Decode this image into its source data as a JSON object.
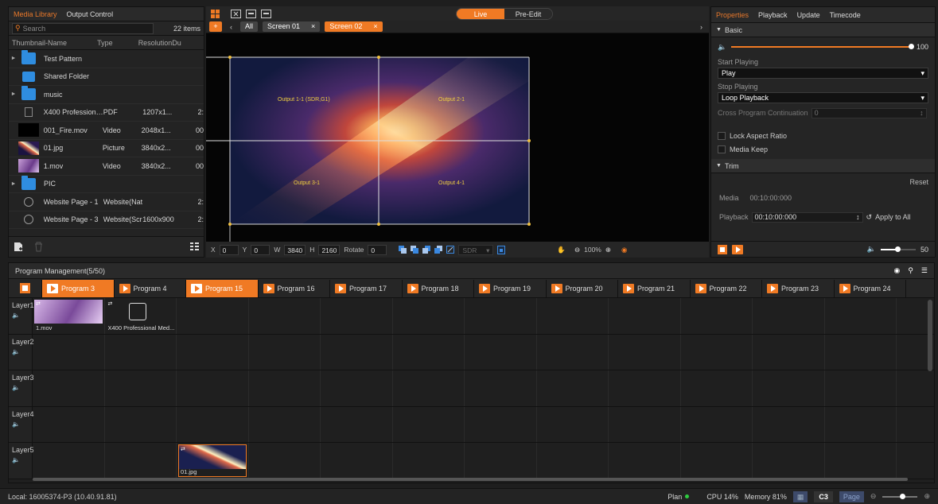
{
  "left_panel": {
    "tabs": [
      "Media Library",
      "Output Control"
    ],
    "search_placeholder": "Search",
    "item_count": "22 items",
    "columns": [
      "Thumbnail-Name",
      "Type",
      "Resolution",
      "Du"
    ],
    "items": [
      {
        "name": "Test Pattern",
        "type": "",
        "res": "",
        "dur": "",
        "kind": "folder",
        "expandable": true
      },
      {
        "name": "Shared Folder",
        "type": "",
        "res": "",
        "dur": "",
        "kind": "shared",
        "expandable": false
      },
      {
        "name": "music",
        "type": "",
        "res": "",
        "dur": "",
        "kind": "folder",
        "expandable": true
      },
      {
        "name": "X400 Professiona...",
        "type": "PDF",
        "res": "1207x1...",
        "dur": "2:",
        "kind": "pdf",
        "expandable": false
      },
      {
        "name": "001_Fire.mov",
        "type": "Video",
        "res": "2048x1...",
        "dur": "00",
        "kind": "black",
        "expandable": false
      },
      {
        "name": "01.jpg",
        "type": "Picture",
        "res": "3840x2...",
        "dur": "00",
        "kind": "galaxy",
        "expandable": false
      },
      {
        "name": "1.mov",
        "type": "Video",
        "res": "3840x2...",
        "dur": "00",
        "kind": "purple",
        "expandable": false
      },
      {
        "name": "PIC",
        "type": "",
        "res": "",
        "dur": "",
        "kind": "folder",
        "expandable": true
      },
      {
        "name": "Website Page - 1",
        "type": "Website(Nat...",
        "res": "",
        "dur": "2:",
        "kind": "globe",
        "expandable": false
      },
      {
        "name": "Website Page - 3",
        "type": "Website(Scr...",
        "res": "1600x900",
        "dur": "2:",
        "kind": "globe",
        "expandable": false
      }
    ]
  },
  "center": {
    "live_label": "Live",
    "preedit_label": "Pre-Edit",
    "screen_tabs": [
      "All",
      "Screen 01",
      "Screen 02"
    ],
    "outputs": [
      "Output 1-1 (SDR,G1)",
      "Output 2-1",
      "Output 3-1",
      "Output 4-1"
    ],
    "toolbar": {
      "x_label": "X",
      "x_value": "0",
      "y_label": "Y",
      "y_value": "0",
      "w_label": "W",
      "w_value": "3840",
      "h_label": "H",
      "h_value": "2160",
      "rotate_label": "Rotate",
      "rotate_value": "0",
      "sdr_label": "SDR",
      "zoom": "100%"
    }
  },
  "right_panel": {
    "tabs": [
      "Properties",
      "Playback",
      "Update",
      "Timecode"
    ],
    "basic_label": "Basic",
    "volume_value": "100",
    "volume_level": 1.0,
    "start_playing_label": "Start Playing",
    "start_playing_value": "Play",
    "stop_playing_label": "Stop Playing",
    "stop_playing_value": "Loop Playback",
    "cross_program_label": "Cross Program Continuation",
    "cross_program_value": "0",
    "lock_aspect_label": "Lock Aspect Ratio",
    "media_keep_label": "Media Keep",
    "trim_label": "Trim",
    "reset_label": "Reset",
    "media_label": "Media",
    "media_time": "00:10:00:000",
    "playback_label": "Playback",
    "playback_time": "00:10:00:000",
    "apply_all_label": "Apply to All",
    "bottom_volume_value": "50",
    "bottom_volume_level": 0.5
  },
  "program": {
    "title": "Program Management(5/50)",
    "tabs": [
      {
        "label": "Program 3",
        "active": true
      },
      {
        "label": "Program 4",
        "active": false
      },
      {
        "label": "Program 15",
        "active": true
      },
      {
        "label": "Program 16",
        "active": false
      },
      {
        "label": "Program 17",
        "active": false
      },
      {
        "label": "Program 18",
        "active": false
      },
      {
        "label": "Program 19",
        "active": false
      },
      {
        "label": "Program 20",
        "active": false
      },
      {
        "label": "Program 21",
        "active": false
      },
      {
        "label": "Program 22",
        "active": false
      },
      {
        "label": "Program 23",
        "active": false
      },
      {
        "label": "Program 24",
        "active": false
      }
    ],
    "layers": [
      "Layer1",
      "Layer2",
      "Layer3",
      "Layer4",
      "Layer5"
    ],
    "clips": [
      {
        "layer": 0,
        "col": 0,
        "name": "1.mov",
        "kind": "purple"
      },
      {
        "layer": 0,
        "col": 1,
        "name": "X400 Professional Med...",
        "kind": "pdf"
      },
      {
        "layer": 4,
        "col": 2,
        "name": "01.jpg",
        "kind": "galaxy"
      }
    ]
  },
  "status": {
    "local": "Local: 16005374-P3 (10.40.91.81)",
    "plan": "Plan",
    "cpu": "CPU 14%",
    "memory": "Memory 81%",
    "c3": "C3",
    "page": "Page"
  },
  "colors": {
    "accent": "#f07a24",
    "folder": "#2f8de0",
    "plan_dot": "#2ecc40"
  }
}
